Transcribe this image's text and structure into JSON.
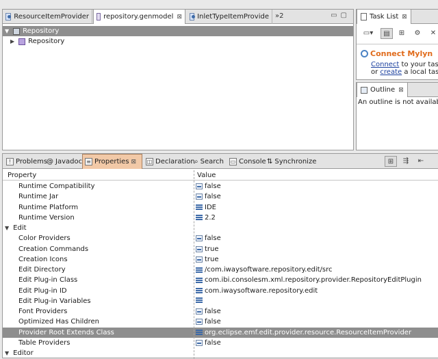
{
  "editor": {
    "tabs": [
      {
        "label": "ResourceItemProvider",
        "icon": "java-class-icon"
      },
      {
        "label": "repository.genmodel",
        "icon": "genmodel-icon",
        "close": "⊠"
      },
      {
        "label": "InletTypeItemProvide",
        "icon": "java-class-icon"
      }
    ],
    "overflow_label": "»2",
    "tree": {
      "root": "Repository",
      "child": "Repository"
    }
  },
  "task_list": {
    "tab_label": "Task List",
    "close": "⊠",
    "mylyn_title": "Connect Mylyn",
    "line1_link": "Connect",
    "line1_text": " to your task a",
    "line2_pre": "or ",
    "line2_link": "create",
    "line2_text": " a local task."
  },
  "outline": {
    "tab_label": "Outline",
    "close": "⊠",
    "message": "An outline is not available."
  },
  "bottom": {
    "tabs": [
      {
        "label": "Problems",
        "icon": "problems-icon"
      },
      {
        "label": "Javadoc",
        "icon": "javadoc-icon"
      },
      {
        "label": "Properties",
        "icon": "properties-icon",
        "close": "⊠"
      },
      {
        "label": "Declaration",
        "icon": "declaration-icon"
      },
      {
        "label": "Search",
        "icon": "search-icon"
      },
      {
        "label": "Console",
        "icon": "console-icon"
      },
      {
        "label": "Synchronize",
        "icon": "synchronize-icon"
      }
    ],
    "headers": {
      "property": "Property",
      "value": "Value"
    },
    "rows": [
      {
        "kind": "item",
        "name": "Runtime Compatibility",
        "value": "false",
        "vtype": "bool"
      },
      {
        "kind": "item",
        "name": "Runtime Jar",
        "value": "false",
        "vtype": "bool"
      },
      {
        "kind": "item",
        "name": "Runtime Platform",
        "value": "IDE",
        "vtype": "text"
      },
      {
        "kind": "item",
        "name": "Runtime Version",
        "value": "2.2",
        "vtype": "text"
      },
      {
        "kind": "category",
        "name": "Edit"
      },
      {
        "kind": "item",
        "name": "Color Providers",
        "value": "false",
        "vtype": "bool"
      },
      {
        "kind": "item",
        "name": "Creation Commands",
        "value": "true",
        "vtype": "bool"
      },
      {
        "kind": "item",
        "name": "Creation Icons",
        "value": "true",
        "vtype": "bool"
      },
      {
        "kind": "item",
        "name": "Edit Directory",
        "value": "/com.iwaysoftware.repository.edit/src",
        "vtype": "text"
      },
      {
        "kind": "item",
        "name": "Edit Plug-in Class",
        "value": "com.ibi.consolesm.xml.repository.provider.RepositoryEditPlugin",
        "vtype": "text"
      },
      {
        "kind": "item",
        "name": "Edit Plug-in ID",
        "value": "com.iwaysoftware.repository.edit",
        "vtype": "text"
      },
      {
        "kind": "item",
        "name": "Edit Plug-in Variables",
        "value": "",
        "vtype": "text"
      },
      {
        "kind": "item",
        "name": "Font Providers",
        "value": "false",
        "vtype": "bool"
      },
      {
        "kind": "item",
        "name": "Optimized Has Children",
        "value": "false",
        "vtype": "bool"
      },
      {
        "kind": "item",
        "name": "Provider Root Extends Class",
        "value": "org.eclipse.emf.edit.provider.resource.ResourceItemProvider",
        "vtype": "text",
        "selected": true
      },
      {
        "kind": "item",
        "name": "Table Providers",
        "value": "false",
        "vtype": "bool"
      },
      {
        "kind": "category",
        "name": "Editor"
      }
    ]
  },
  "colors": {
    "selection": "#8e8e8e",
    "active_tab": "#f2c9a7",
    "mylyn": "#e06a1a",
    "link": "#1a3f9e"
  }
}
